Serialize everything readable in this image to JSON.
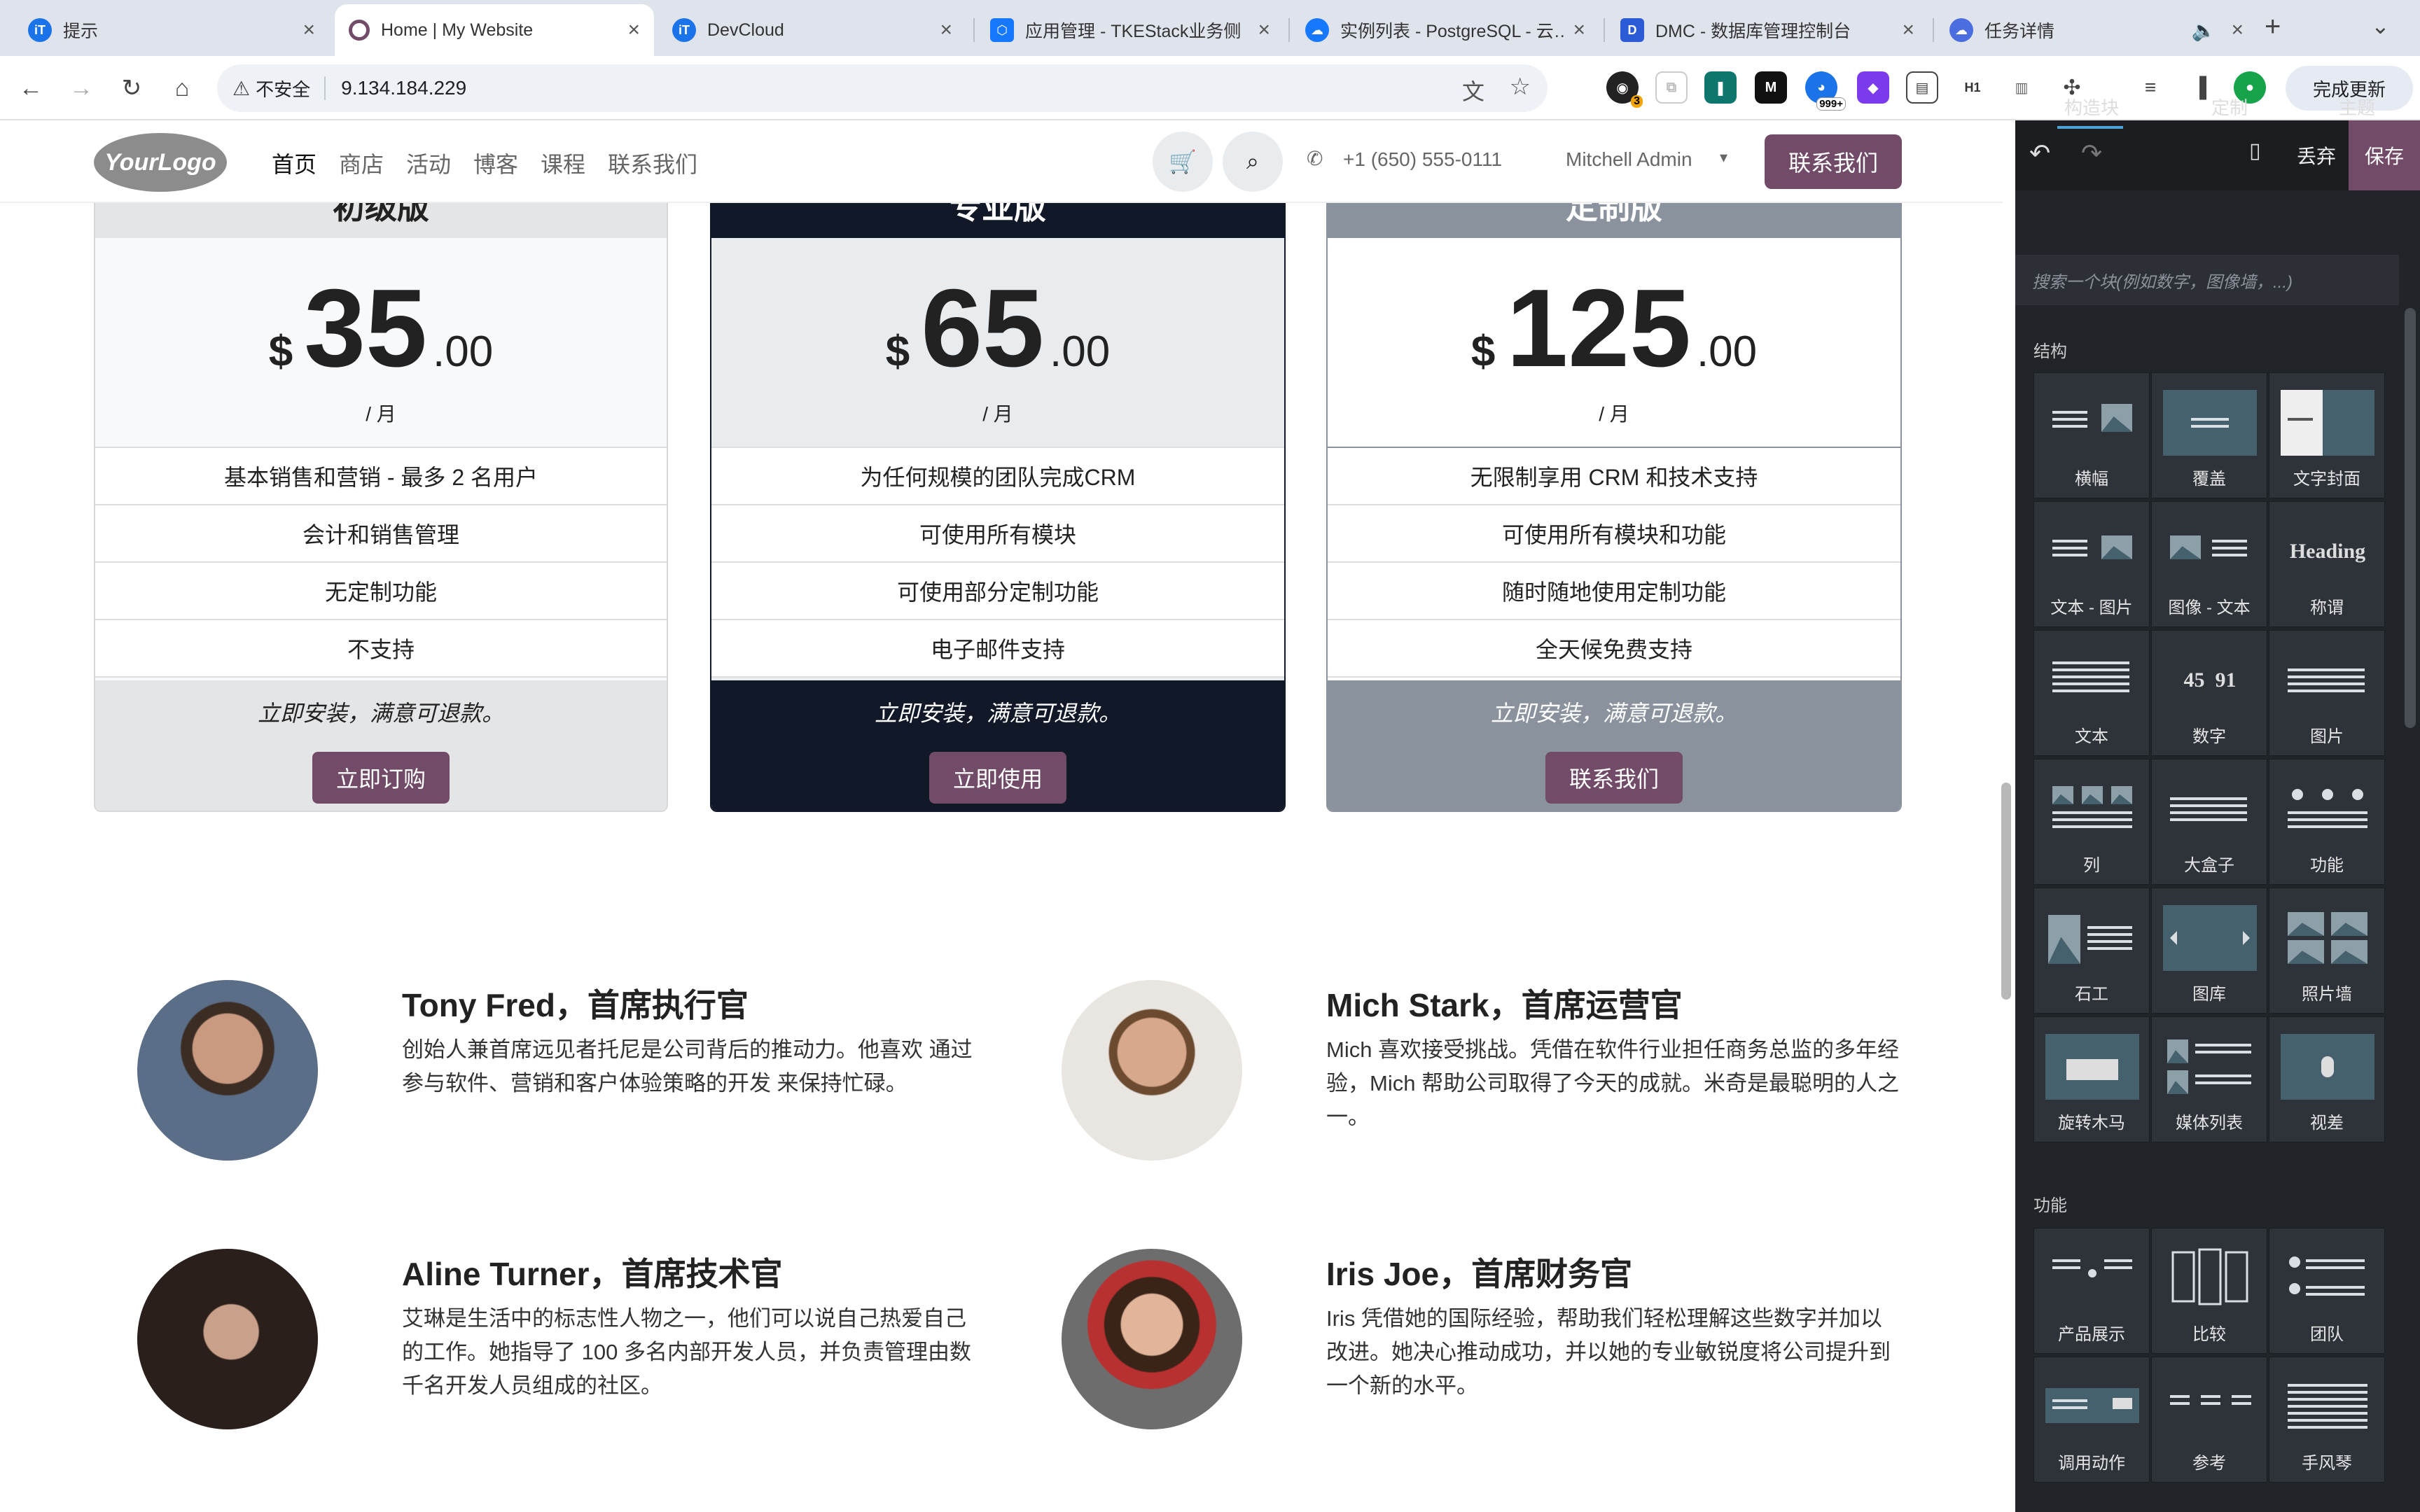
{
  "browser": {
    "tabs": [
      {
        "title": "提示",
        "favicon_color": "#1a73e8",
        "favicon_text": "iT"
      },
      {
        "title": "Home | My Website",
        "favicon_color": "#714b67",
        "favicon_text": "○"
      },
      {
        "title": "DevCloud",
        "favicon_color": "#1a73e8",
        "favicon_text": "iT"
      },
      {
        "title": "应用管理 - TKEStack业务侧",
        "favicon_color": "#1677ff",
        "favicon_text": "⬡"
      },
      {
        "title": "实例列表 - PostgreSQL - 云…",
        "favicon_color": "#1677ff",
        "favicon_text": "☁"
      },
      {
        "title": "DMC - 数据库管理控制台",
        "favicon_color": "#2c5bd6",
        "favicon_text": "D"
      },
      {
        "title": "任务详情",
        "favicon_color": "#4a6ee0",
        "favicon_text": "☁"
      }
    ],
    "new_tab": "+",
    "address": {
      "security_label": "不安全",
      "url": "9.134.184.229"
    },
    "ext_badges": {
      "count_a": "3",
      "count_b": "999+",
      "h1": "H1"
    },
    "update_button": "完成更新"
  },
  "site": {
    "logo_text": "YourLogo",
    "nav": [
      "首页",
      "商店",
      "活动",
      "博客",
      "课程",
      "联系我们"
    ],
    "phone": "+1 (650) 555-0111",
    "user": "Mitchell Admin",
    "contact_button": "联系我们"
  },
  "pricing": [
    {
      "name": "初级版",
      "currency": "$",
      "amount": "35",
      "decimals": ".00",
      "period": "/ 月",
      "features": [
        "基本销售和营销 - 最多 2 名用户",
        "会计和销售管理",
        "无定制功能",
        "不支持"
      ],
      "note": "立即安装，满意可退款。",
      "button": "立即订购",
      "header_bg": "#e4e5e7",
      "footer_bg": "#e4e5e7"
    },
    {
      "name": "专业版",
      "currency": "$",
      "amount": "65",
      "decimals": ".00",
      "period": "/ 月",
      "features": [
        "为任何规模的团队完成CRM",
        "可使用所有模块",
        "可使用部分定制功能",
        "电子邮件支持"
      ],
      "note": "立即安装，满意可退款。",
      "button": "立即使用",
      "header_bg": "#111827",
      "footer_bg": "#111827"
    },
    {
      "name": "定制版",
      "currency": "$",
      "amount": "125",
      "decimals": ".00",
      "period": "/ 月",
      "features": [
        "无限制享用 CRM 和技术支持",
        "可使用所有模块和功能",
        "随时随地使用定制功能",
        "全天候免费支持"
      ],
      "note": "立即安装，满意可退款。",
      "button": "联系我们",
      "header_bg": "#8a939d",
      "footer_bg": "#8a939d"
    }
  ],
  "team": [
    {
      "name": "Tony Fred，首席执行官",
      "bio": "创始人兼首席远见者托尼是公司背后的推动力。他喜欢 通过参与软件、营销和客户体验策略的开发 来保持忙碌。"
    },
    {
      "name": "Mich Stark，首席运营官",
      "bio": "Mich 喜欢接受挑战。凭借在软件行业担任商务总监的多年经验，Mich 帮助公司取得了今天的成就。米奇是最聪明的人之一。"
    },
    {
      "name": "Aline Turner，首席技术官",
      "bio": "艾琳是生活中的标志性人物之一，他们可以说自己热爱自己的工作。她指导了 100 多名内部开发人员，并负责管理由数千名开发人员组成的社区。"
    },
    {
      "name": "Iris Joe，首席财务官",
      "bio": "Iris 凭借她的国际经验，帮助我们轻松理解这些数字并加以改进。她决心推动成功，并以她的专业敏锐度将公司提升到一个新的水平。"
    }
  ],
  "editor": {
    "discard": "丢弃",
    "save": "保存",
    "tabs": [
      "构造块",
      "定制",
      "主题"
    ],
    "search_placeholder": "搜索一个块(例如数字，图像墙，...)",
    "structure_title": "结构",
    "structure_blocks": [
      "横幅",
      "覆盖",
      "文字封面",
      "文本 - 图片",
      "图像 - 文本",
      "称谓",
      "文本",
      "数字",
      "图片",
      "列",
      "大盒子",
      "功能",
      "石工",
      "图库",
      "照片墙",
      "旋转木马",
      "媒体列表",
      "视差"
    ],
    "features_title": "功能",
    "feature_blocks": [
      "产品展示",
      "比较",
      "团队",
      "调用动作",
      "参考",
      "手风琴"
    ],
    "heading_thumb": "Heading",
    "numbers_thumb": "45  91"
  }
}
